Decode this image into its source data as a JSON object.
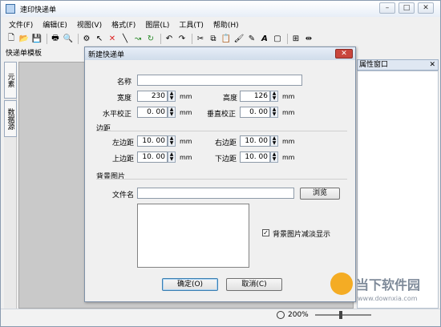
{
  "window": {
    "title": "速印快递单"
  },
  "menubar": {
    "items": [
      "文件(F)",
      "编辑(E)",
      "视图(V)",
      "格式(F)",
      "图层(L)",
      "工具(T)",
      "帮助(H)"
    ]
  },
  "left_panel": {
    "title": "快递单模板",
    "tabs": [
      "元素",
      "数据源"
    ]
  },
  "right_panel": {
    "title": "属性窗口",
    "close_glyph": "✕"
  },
  "status": {
    "zoom": "200%"
  },
  "dialog": {
    "title": "新建快递单",
    "name_label": "名称",
    "name_value": "",
    "width_label": "宽度",
    "width_value": "230",
    "height_label": "高度",
    "height_value": "126",
    "hcorr_label": "水平校正",
    "hcorr_value": "0. 00",
    "vcorr_label": "垂直校正",
    "vcorr_value": "0. 00",
    "unit": "mm",
    "margin_section": "边距",
    "left_label": "左边距",
    "left_value": "10. 00",
    "right_label": "右边距",
    "right_value": "10. 00",
    "top_label": "上边距",
    "top_value": "10. 00",
    "bottom_label": "下边距",
    "bottom_value": "10. 00",
    "bg_section": "背景图片",
    "file_label": "文件名",
    "file_value": "",
    "browse_button": "浏览",
    "fade_checkbox": "背景图片减淡显示",
    "ok_button": "确定(O)",
    "cancel_button": "取消(C)"
  },
  "watermark": {
    "text": "当下软件园",
    "url": "www.downxia.com"
  }
}
